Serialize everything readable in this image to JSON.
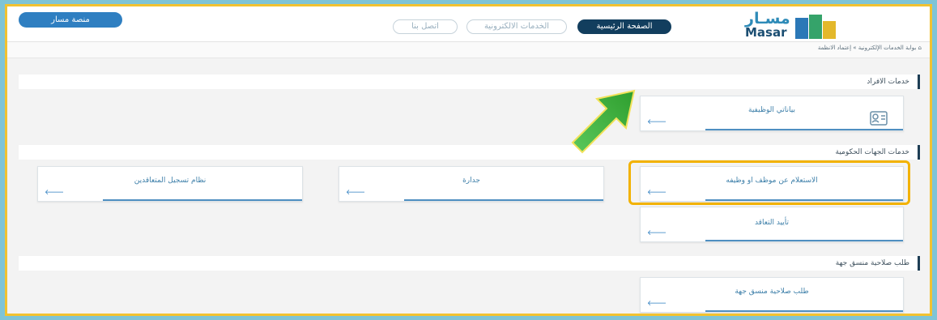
{
  "header": {
    "platform_button": "منصة مسار",
    "nav": {
      "home": "الصفحة الرئيسية",
      "eservices": "الخدمات الالكترونية",
      "contact": "اتصل بنا"
    },
    "logo": {
      "arabic": "مسـار",
      "english": "Masar"
    }
  },
  "breadcrumb": "بوابة الخدمات الإلكترونية » إعتماد الانظمة",
  "sections": {
    "individuals": {
      "title": "خدمات الافراد",
      "cards": [
        {
          "label": "بياناتي الوظيفية",
          "icon": "profile-card-icon"
        }
      ]
    },
    "government": {
      "title": "خدمات الجهات الحكومية",
      "cards": [
        {
          "label": "الاستعلام عن موظف او وظيفه"
        },
        {
          "label": "جدارة"
        },
        {
          "label": "نظام تسجيل المتعاقدين"
        },
        {
          "label": "تأييد التعاقد"
        }
      ]
    },
    "coordinator": {
      "title": "طلب صلاحية منسق جهة",
      "cards": [
        {
          "label": "طلب صلاحية منسق جهة"
        }
      ]
    }
  },
  "arrow_glyph": "🡐",
  "colors": {
    "highlight": "#f2b200",
    "accent_blue": "#2f7fc1",
    "nav_dark": "#123e5e",
    "arrow_green": "#3cb33c"
  }
}
